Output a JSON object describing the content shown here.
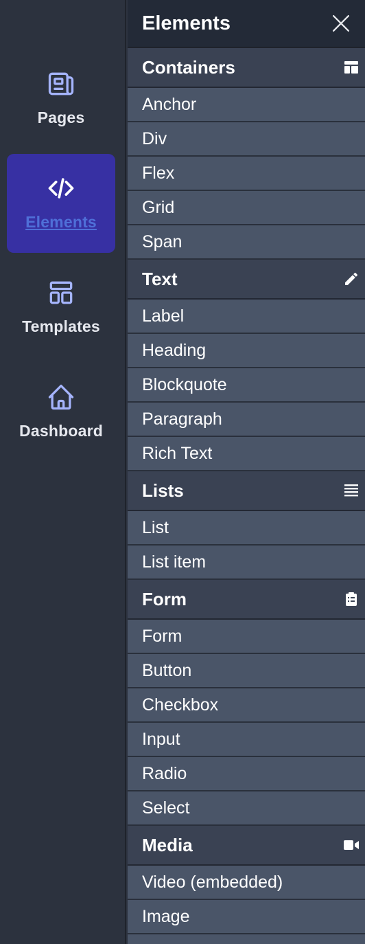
{
  "nav": {
    "items": [
      {
        "label": "Pages",
        "icon": "newspaper-icon"
      },
      {
        "label": "Elements",
        "icon": "code-icon",
        "active": true
      },
      {
        "label": "Templates",
        "icon": "layout-icon"
      },
      {
        "label": "Dashboard",
        "icon": "home-icon"
      }
    ]
  },
  "panel": {
    "title": "Elements",
    "sections": [
      {
        "title": "Containers",
        "icon": "layout-dashboard-icon",
        "items": [
          "Anchor",
          "Div",
          "Flex",
          "Grid",
          "Span"
        ]
      },
      {
        "title": "Text",
        "icon": "pencil-icon",
        "items": [
          "Label",
          "Heading",
          "Blockquote",
          "Paragraph",
          "Rich Text"
        ]
      },
      {
        "title": "Lists",
        "icon": "list-icon",
        "items": [
          "List",
          "List item"
        ]
      },
      {
        "title": "Form",
        "icon": "clipboard-list-icon",
        "items": [
          "Form",
          "Button",
          "Checkbox",
          "Input",
          "Radio",
          "Select"
        ]
      },
      {
        "title": "Media",
        "icon": "video-camera-icon",
        "items": [
          "Video (embedded)",
          "Image"
        ]
      }
    ]
  },
  "colors": {
    "accent_active": "#3730a3",
    "active_label": "#4f6fd8",
    "icon_tint": "#a5b4fc",
    "panel_bg": "#4a5568",
    "header_bg": "#232a37",
    "section_bg": "#3a4253"
  }
}
